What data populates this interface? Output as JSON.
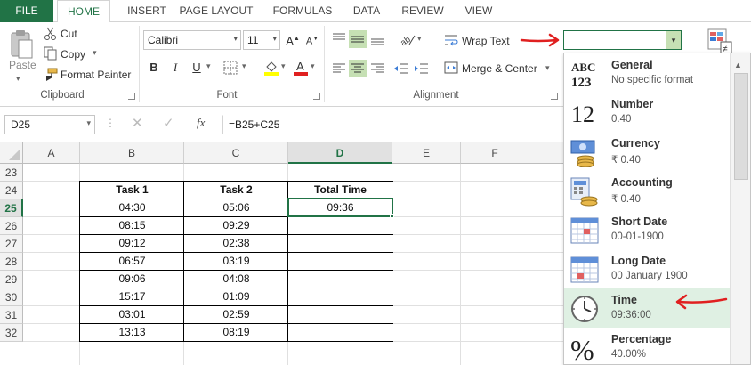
{
  "tabs": [
    "FILE",
    "HOME",
    "INSERT",
    "PAGE LAYOUT",
    "FORMULAS",
    "DATA",
    "REVIEW",
    "VIEW"
  ],
  "clipboard": {
    "paste": "Paste",
    "cut": "Cut",
    "copy": "Copy",
    "format_painter": "Format Painter",
    "label": "Clipboard"
  },
  "font": {
    "name": "Calibri",
    "size": "11",
    "label": "Font",
    "bold": "B",
    "italic": "I",
    "underline": "U"
  },
  "alignment": {
    "wrap_text": "Wrap Text",
    "merge_center": "Merge & Center",
    "label": "Alignment"
  },
  "number_format_value": "",
  "formula_bar": {
    "name_box": "D25",
    "fx": "fx",
    "formula": "=B25+C25"
  },
  "columns": [
    "A",
    "B",
    "C",
    "D",
    "E",
    "F"
  ],
  "rows": [
    "23",
    "24",
    "25",
    "26",
    "27",
    "28",
    "29",
    "30",
    "31",
    "32"
  ],
  "table": {
    "headers": [
      "Task 1",
      "Task 2",
      "Total Time"
    ],
    "rows": [
      [
        "04:30",
        "05:06",
        "09:36"
      ],
      [
        "08:15",
        "09:29",
        ""
      ],
      [
        "09:12",
        "02:38",
        ""
      ],
      [
        "06:57",
        "03:19",
        ""
      ],
      [
        "09:06",
        "04:08",
        ""
      ],
      [
        "15:17",
        "01:09",
        ""
      ],
      [
        "03:01",
        "02:59",
        ""
      ],
      [
        "13:13",
        "08:19",
        ""
      ]
    ]
  },
  "formats": [
    {
      "title": "General",
      "sample": "No specific format",
      "icon": "general-icon",
      "glyph": "ABC 123"
    },
    {
      "title": "Number",
      "sample": "0.40",
      "icon": "number-icon",
      "glyph": "12"
    },
    {
      "title": "Currency",
      "sample": "₹ 0.40",
      "icon": "currency-icon"
    },
    {
      "title": "Accounting",
      "sample": "₹ 0.40",
      "icon": "accounting-icon"
    },
    {
      "title": "Short Date",
      "sample": "00-01-1900",
      "icon": "short-date-icon"
    },
    {
      "title": "Long Date",
      "sample": "00 January 1900",
      "icon": "long-date-icon"
    },
    {
      "title": "Time",
      "sample": "09:36:00",
      "icon": "clock-icon"
    },
    {
      "title": "Percentage",
      "sample": "40.00%",
      "icon": "percentage-icon",
      "glyph": "%"
    }
  ],
  "colors": {
    "excel_green": "#217346",
    "highlight": "#dff0e3",
    "arrow_red": "#e02020"
  }
}
